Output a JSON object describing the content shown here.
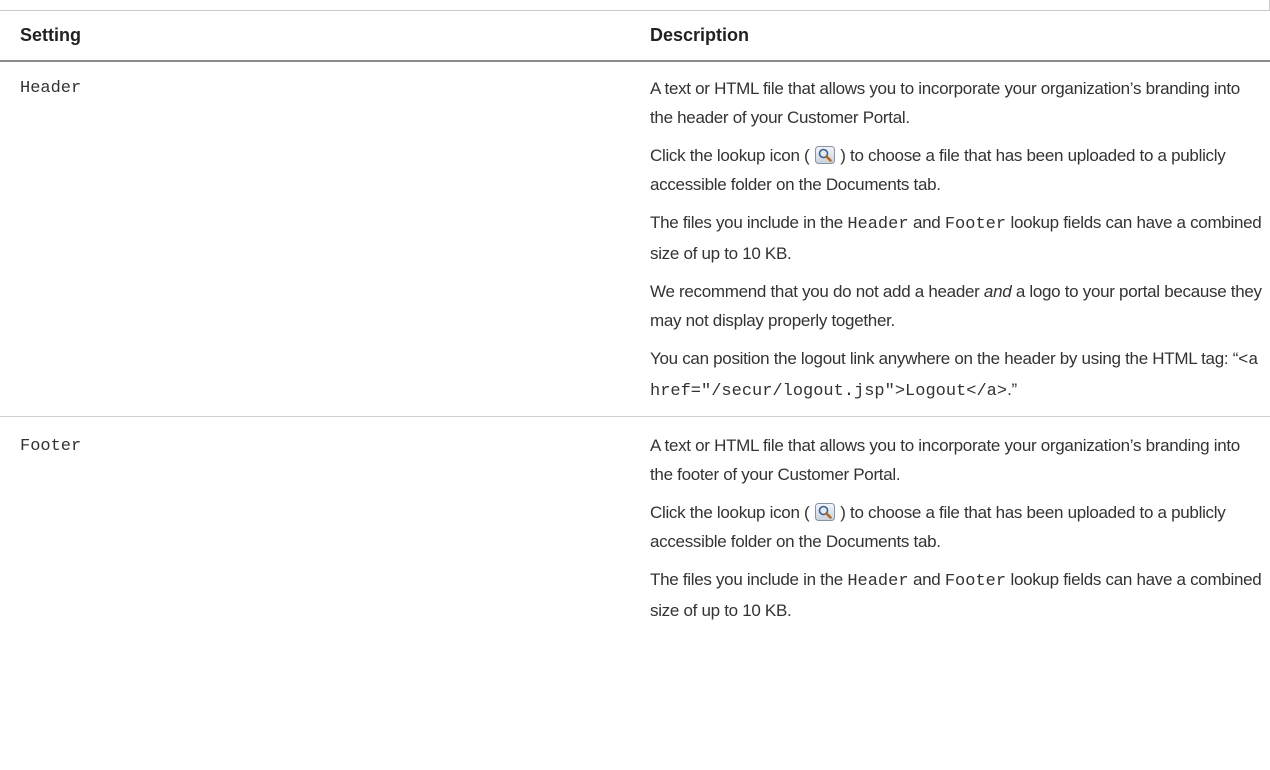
{
  "table": {
    "header": {
      "setting": "Setting",
      "description": "Description"
    },
    "rows": [
      {
        "setting": "Header",
        "p1": "A text or HTML file that allows you to incorporate your organization’s branding into the header of your Customer Portal.",
        "p2_before": "Click the lookup icon ( ",
        "p2_after": " ) to choose a file that has been uploaded to a publicly accessible folder on the Documents tab.",
        "p3_a": "The files you include in the ",
        "p3_code1": "Header",
        "p3_b": " and ",
        "p3_code2": "Footer",
        "p3_c": " lookup fields can have a combined size of up to 10 KB.",
        "p4_a": "We recommend that you do not add a header ",
        "p4_em": "and",
        "p4_b": " a logo to your portal because they may not display properly together.",
        "p5_a": "You can position the logout link anywhere on the header by using the HTML tag: “",
        "p5_code1": "<a",
        "p5_code2": "href=\"/secur/logout.jsp\">Logout</a>",
        "p5_end": ".”"
      },
      {
        "setting": "Footer",
        "p1": "A text or HTML file that allows you to incorporate your organization’s branding into the footer of your Customer Portal.",
        "p2_before": "Click the lookup icon ( ",
        "p2_after": " ) to choose a file that has been uploaded to a publicly accessible folder on the Documents tab.",
        "p3_a": "The files you include in the ",
        "p3_code1": "Header",
        "p3_b": " and ",
        "p3_code2": "Footer",
        "p3_c": " lookup fields can have a combined size of up to 10 KB."
      }
    ]
  },
  "icons": {
    "lookup": "lookup-icon"
  }
}
